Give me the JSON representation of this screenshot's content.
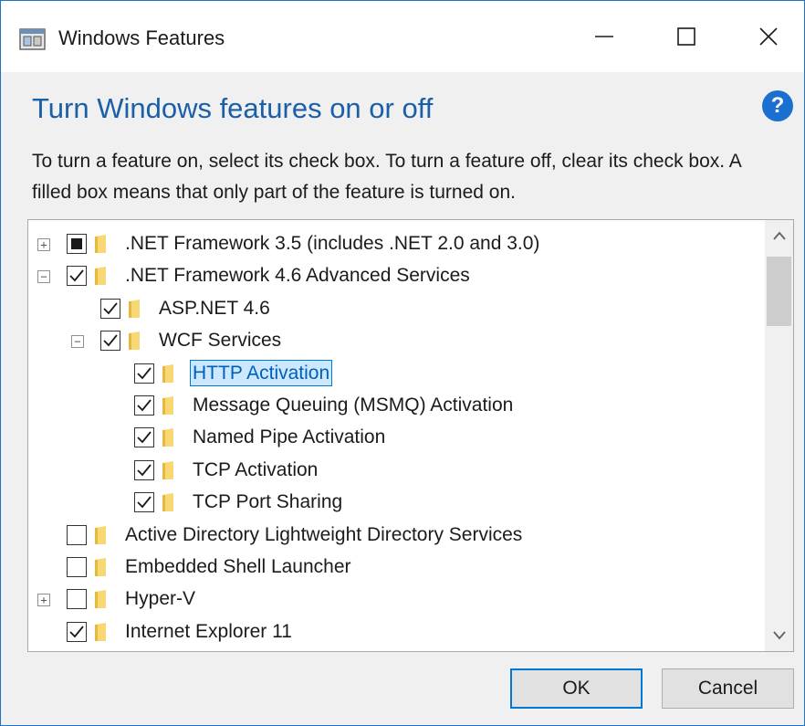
{
  "window": {
    "title": "Windows Features",
    "icons": {
      "app": "windows-features-icon",
      "minimize": "minimize-icon",
      "maximize": "maximize-icon",
      "close": "close-icon"
    }
  },
  "dialog": {
    "heading": "Turn Windows features on or off",
    "help_label": "?",
    "description": "To turn a feature on, select its check box. To turn a feature off, clear its check box. A filled box means that only part of the feature is turned on."
  },
  "features": [
    {
      "label": ".NET Framework 3.5 (includes .NET 2.0 and 3.0)",
      "state": "partial",
      "level": 0,
      "expander": "+",
      "selected": false
    },
    {
      "label": ".NET Framework 4.6 Advanced Services",
      "state": "checked",
      "level": 0,
      "expander": "−",
      "selected": false
    },
    {
      "label": "ASP.NET 4.6",
      "state": "checked",
      "level": 1,
      "expander": "",
      "selected": false
    },
    {
      "label": "WCF Services",
      "state": "checked",
      "level": 1,
      "expander": "−",
      "selected": false
    },
    {
      "label": "HTTP Activation",
      "state": "checked",
      "level": 2,
      "expander": "",
      "selected": true
    },
    {
      "label": "Message Queuing (MSMQ) Activation",
      "state": "checked",
      "level": 2,
      "expander": "",
      "selected": false
    },
    {
      "label": "Named Pipe Activation",
      "state": "checked",
      "level": 2,
      "expander": "",
      "selected": false
    },
    {
      "label": "TCP Activation",
      "state": "checked",
      "level": 2,
      "expander": "",
      "selected": false
    },
    {
      "label": "TCP Port Sharing",
      "state": "checked",
      "level": 2,
      "expander": "",
      "selected": false
    },
    {
      "label": "Active Directory Lightweight Directory Services",
      "state": "unchecked",
      "level": 0,
      "expander": "",
      "selected": false
    },
    {
      "label": "Embedded Shell Launcher",
      "state": "unchecked",
      "level": 0,
      "expander": "",
      "selected": false
    },
    {
      "label": "Hyper-V",
      "state": "unchecked",
      "level": 0,
      "expander": "+",
      "selected": false
    },
    {
      "label": "Internet Explorer 11",
      "state": "checked",
      "level": 0,
      "expander": "",
      "selected": false
    }
  ],
  "buttons": {
    "ok": "OK",
    "cancel": "Cancel"
  },
  "colors": {
    "accent": "#0078d7",
    "heading": "#1a5fa8",
    "folder": "#f8d775",
    "selection": "#cce8ff"
  }
}
